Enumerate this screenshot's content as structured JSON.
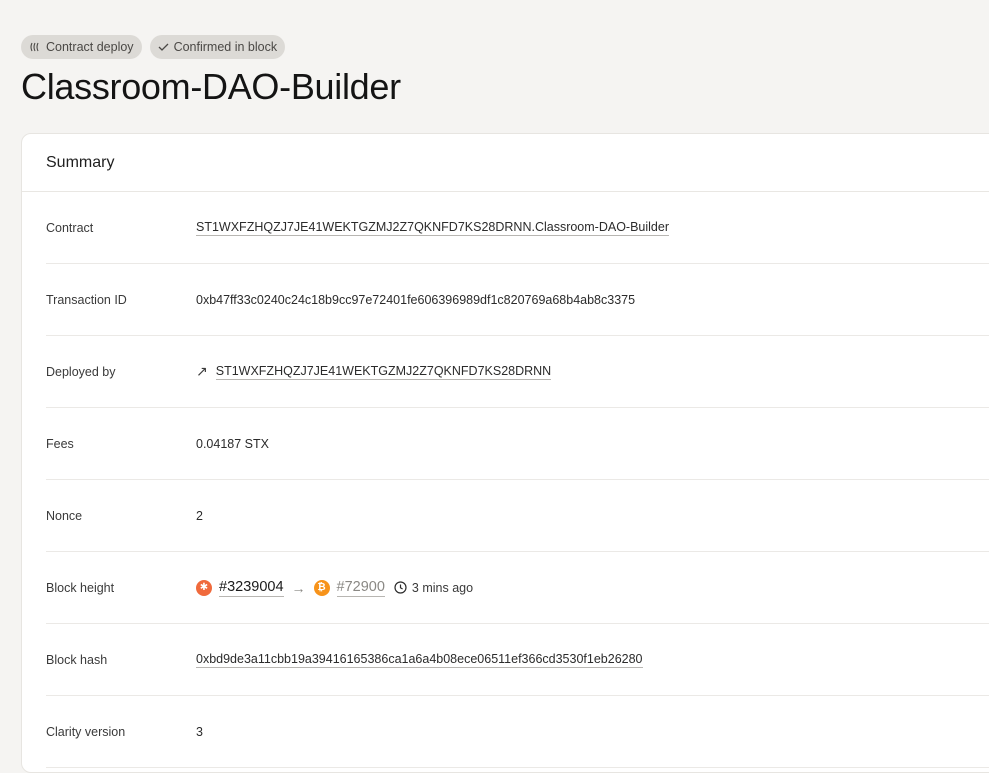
{
  "badges": {
    "type_label": "Contract deploy",
    "status_label": "Confirmed in block"
  },
  "title": "Classroom-DAO-Builder",
  "summary": {
    "header": "Summary",
    "rows": [
      {
        "label": "Contract",
        "value": "ST1WXFZHQZJ7JE41WEKTGZMJ2Z7QKNFD7KS28DRNN.Classroom-DAO-Builder"
      },
      {
        "label": "Transaction ID",
        "value": "0xb47ff33c0240c24c18b9cc97e72401fe606396989df1c820769a68b4ab8c3375"
      },
      {
        "label": "Deployed by",
        "value": "ST1WXFZHQZJ7JE41WEKTGZMJ2Z7QKNFD7KS28DRNN"
      },
      {
        "label": "Fees",
        "value": "0.04187 STX"
      },
      {
        "label": "Nonce",
        "value": "2"
      },
      {
        "label": "Block height",
        "stacks_block": "#3239004",
        "bitcoin_block": "#72900",
        "time": "3 mins ago"
      },
      {
        "label": "Block hash",
        "value": "0xbd9de3a11cbb19a39416165386ca1a6a4b08ece06511ef366cd3530f1eb26280"
      },
      {
        "label": "Clarity version",
        "value": "3"
      }
    ]
  },
  "colors": {
    "stacks_orange": "#f06a3c",
    "bitcoin_orange": "#f7931a",
    "page_bg": "#f5f4f2"
  },
  "icons": {
    "type_badge": "clarity-icon",
    "status_badge": "check-icon",
    "deployer": "arrow-up-right-icon",
    "stacks": "stacks-logo-icon",
    "bitcoin": "bitcoin-logo-icon",
    "time": "clock-icon"
  }
}
